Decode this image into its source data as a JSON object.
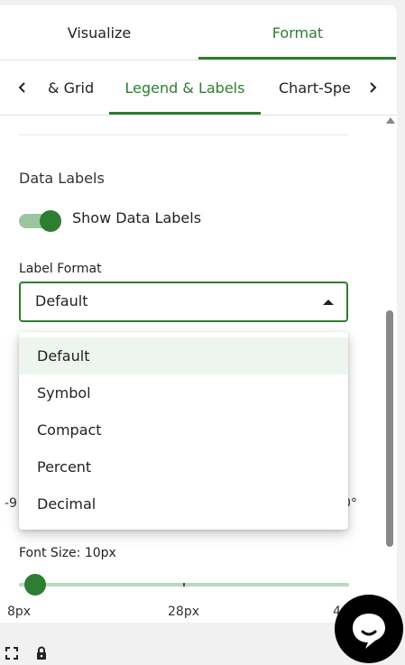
{
  "top_tabs": {
    "visualize": "Visualize",
    "format": "Format"
  },
  "sub_tabs": {
    "grid": "& Grid",
    "legend": "Legend & Labels",
    "chart_specific": "Chart-Spe"
  },
  "data_labels": {
    "title": "Data Labels",
    "toggle_label": "Show Data Labels",
    "enabled": true
  },
  "label_format": {
    "label": "Label Format",
    "value": "Default",
    "options": [
      "Default",
      "Symbol",
      "Compact",
      "Percent",
      "Decimal"
    ]
  },
  "hidden_slider": {
    "left_fragment": "-9",
    "right_fragment": "0°"
  },
  "font_size": {
    "label": "Font Size: 10px",
    "min_label": "8px",
    "mid_label": "28px",
    "max_label": "4",
    "value_fraction": 0.05
  },
  "colors": {
    "accent": "#2e7d32",
    "track": "#9bc59e",
    "selected_bg": "#eef4ee"
  },
  "icons": [
    "chevron-left-icon",
    "chevron-right-icon",
    "caret-up-icon",
    "chat-icon",
    "fullscreen-icon",
    "lock-icon"
  ]
}
